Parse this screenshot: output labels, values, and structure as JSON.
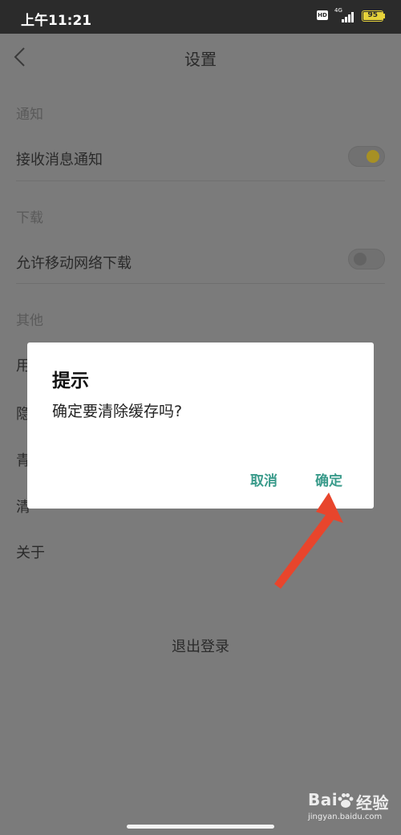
{
  "status_bar": {
    "time": "上午11:21",
    "hd": "HD",
    "network": "4G",
    "battery": "95",
    "battery_level": 0.95
  },
  "header": {
    "back_icon": "chevron-left-icon",
    "title": "设置"
  },
  "sections": {
    "notify": {
      "title": "通知",
      "receive_label": "接收消息通知",
      "receive_on": true
    },
    "download": {
      "title": "下载",
      "mobile_label": "允许移动网络下载",
      "mobile_on": false
    },
    "other": {
      "title": "其他",
      "items": [
        "用",
        "隐",
        "青",
        "清"
      ],
      "about": "关于"
    }
  },
  "logout_label": "退出登录",
  "dialog": {
    "title": "提示",
    "message": "确定要清除缓存吗?",
    "cancel_label": "取消",
    "ok_label": "确定"
  },
  "annotation": {
    "arrow_color": "#e8452c"
  },
  "watermark": {
    "brand_left": "Bai",
    "brand_right": "经验",
    "url": "jingyan.baidu.com"
  },
  "colors": {
    "accent": "#3a9b8b",
    "toggle_on": "#e6c229"
  }
}
